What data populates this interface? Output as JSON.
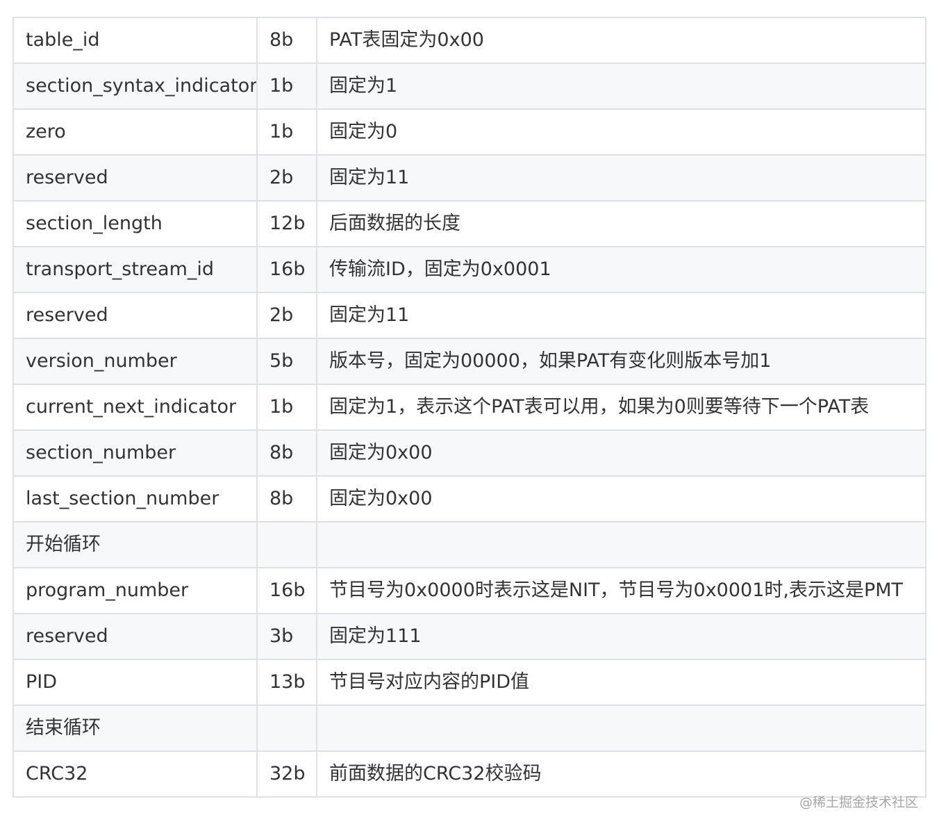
{
  "table": {
    "rows": [
      {
        "field": "table_id",
        "bits": "8b",
        "desc": "PAT表固定为0x00"
      },
      {
        "field": "section_syntax_indicator",
        "bits": "1b",
        "desc": "固定为1"
      },
      {
        "field": "zero",
        "bits": "1b",
        "desc": "固定为0"
      },
      {
        "field": "reserved",
        "bits": "2b",
        "desc": "固定为11"
      },
      {
        "field": "section_length",
        "bits": "12b",
        "desc": "后面数据的长度"
      },
      {
        "field": "transport_stream_id",
        "bits": "16b",
        "desc": "传输流ID，固定为0x0001"
      },
      {
        "field": "reserved",
        "bits": "2b",
        "desc": "固定为11"
      },
      {
        "field": "version_number",
        "bits": "5b",
        "desc": "版本号，固定为00000，如果PAT有变化则版本号加1"
      },
      {
        "field": "current_next_indicator",
        "bits": "1b",
        "desc": "固定为1，表示这个PAT表可以用，如果为0则要等待下一个PAT表"
      },
      {
        "field": "section_number",
        "bits": "8b",
        "desc": "固定为0x00"
      },
      {
        "field": "last_section_number",
        "bits": "8b",
        "desc": "固定为0x00"
      },
      {
        "field": "开始循环",
        "bits": "",
        "desc": ""
      },
      {
        "field": "program_number",
        "bits": "16b",
        "desc": "节目号为0x0000时表示这是NIT，节目号为0x0001时,表示这是PMT"
      },
      {
        "field": "reserved",
        "bits": "3b",
        "desc": "固定为111"
      },
      {
        "field": "PID",
        "bits": "13b",
        "desc": "节目号对应内容的PID值"
      },
      {
        "field": "结束循环",
        "bits": "",
        "desc": ""
      },
      {
        "field": "CRC32",
        "bits": "32b",
        "desc": "前面数据的CRC32校验码"
      }
    ]
  },
  "watermark": "@稀土掘金技术社区",
  "colors": {
    "border": "#dfe2e5",
    "stripe": "#f6f8fa",
    "text": "#333333",
    "watermark": "#a6a6a6"
  }
}
